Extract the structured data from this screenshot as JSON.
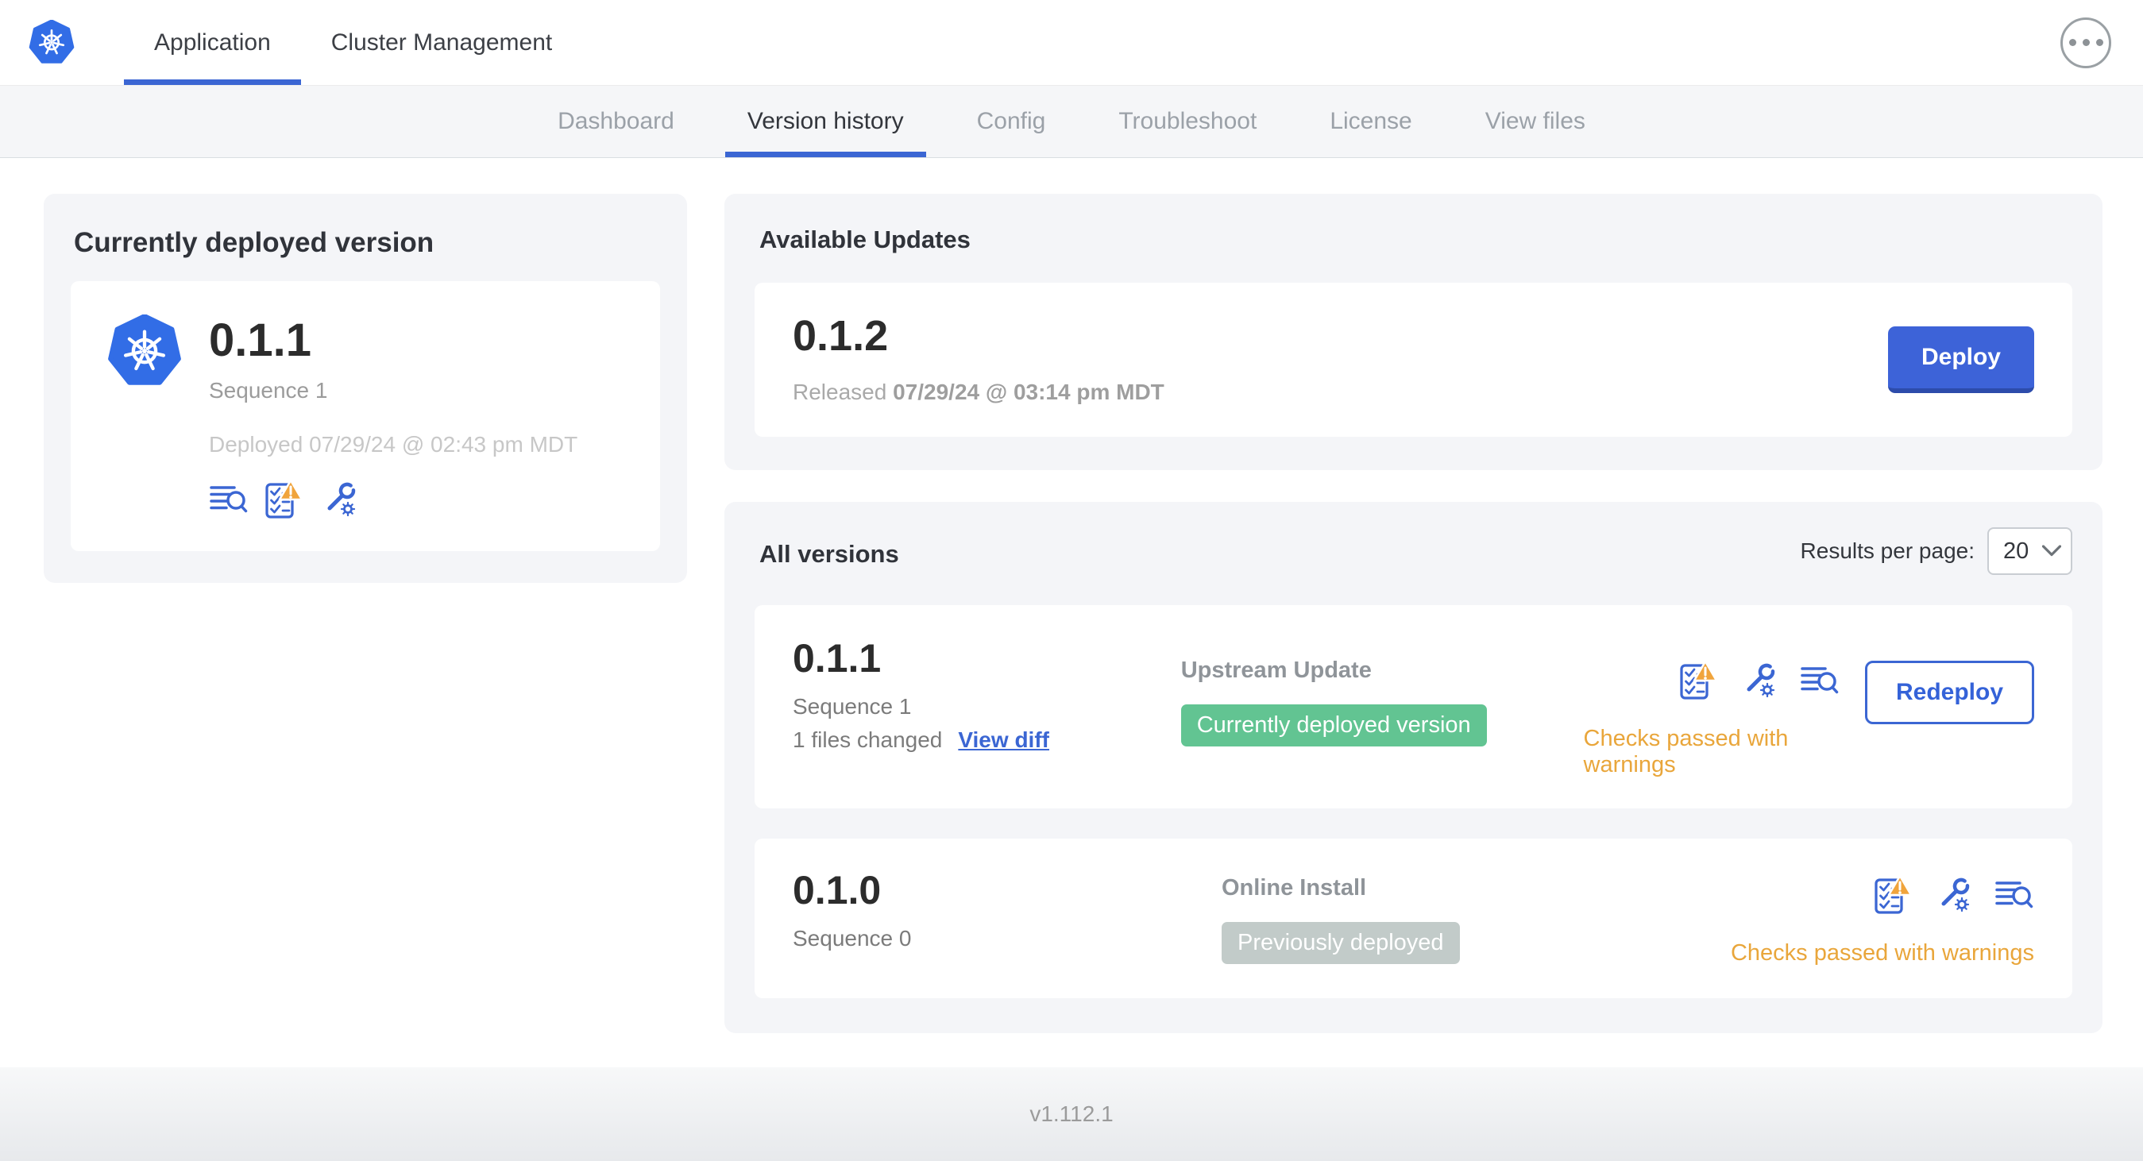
{
  "header": {
    "logo_icon": "kubernetes-logo-icon",
    "tabs": [
      {
        "label": "Application",
        "active": true
      },
      {
        "label": "Cluster Management",
        "active": false
      }
    ],
    "overflow_menu_icon": "ellipsis-icon"
  },
  "subnav": {
    "tabs": [
      {
        "label": "Dashboard",
        "active": false
      },
      {
        "label": "Version history",
        "active": true
      },
      {
        "label": "Config",
        "active": false
      },
      {
        "label": "Troubleshoot",
        "active": false
      },
      {
        "label": "License",
        "active": false
      },
      {
        "label": "View files",
        "active": false
      }
    ]
  },
  "currently_deployed": {
    "title": "Currently deployed version",
    "version": "0.1.1",
    "sequence": "Sequence 1",
    "deployed_label": "Deployed 07/29/24 @ 02:43 pm MDT",
    "icons": [
      "logs-icon",
      "preflight-checks-warning-icon",
      "config-icon"
    ]
  },
  "available_updates": {
    "title": "Available Updates",
    "version": "0.1.2",
    "released_prefix": "Released",
    "released_date": "07/29/24 @ 03:14 pm MDT",
    "deploy_button": "Deploy"
  },
  "all_versions": {
    "title": "All versions",
    "results_per_page_label": "Results per page:",
    "results_per_page_value": "20",
    "rows": [
      {
        "version": "0.1.1",
        "sequence": "Sequence 1",
        "files_changed": "1 files changed",
        "view_diff_link": "View diff",
        "source": "Upstream Update",
        "badge": "Currently deployed version",
        "badge_color": "#62c492",
        "icons": [
          "preflight-checks-warning-icon",
          "config-icon",
          "logs-icon"
        ],
        "action_button": "Redeploy",
        "status": "Checks passed with warnings"
      },
      {
        "version": "0.1.0",
        "sequence": "Sequence 0",
        "source": "Online Install",
        "badge": "Previously deployed",
        "badge_color": "#c2cbc9",
        "icons": [
          "preflight-checks-warning-icon",
          "config-icon",
          "logs-icon"
        ],
        "status": "Checks passed with warnings"
      }
    ]
  },
  "footer": {
    "version": "v1.112.1"
  },
  "colors": {
    "primary_blue": "#3b66d3",
    "kubernetes_blue": "#326de6",
    "deploy_button_blue": "#3d63d8",
    "success_green": "#62c492",
    "inactive_badge_gray": "#c2cbc9",
    "warning_amber": "#e9a63b",
    "subnav_bg": "#f5f6f8",
    "panel_bg": "#f4f5f8"
  }
}
